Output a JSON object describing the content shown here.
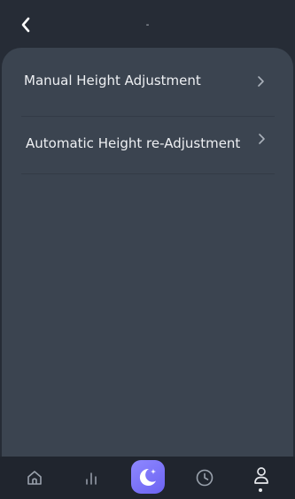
{
  "header": {
    "title": "-",
    "back_icon": "chevron-left-icon"
  },
  "menu": {
    "items": [
      {
        "label": "Manual Height Adjustment",
        "icon": "chevron-right-icon"
      },
      {
        "label": "Automatic Height re-Adjustment",
        "icon": "chevron-right-icon"
      }
    ]
  },
  "bottom_nav": {
    "items": [
      {
        "icon": "home-icon"
      },
      {
        "icon": "bar-chart-icon"
      },
      {
        "icon": "moon-star-icon",
        "selected": true
      },
      {
        "icon": "clock-icon"
      },
      {
        "icon": "user-icon",
        "active": true
      }
    ]
  },
  "colors": {
    "background": "#262c36",
    "panel": "#3b4450",
    "nav_background": "#20252e",
    "accent": "#7a72f7",
    "text": "#eef0f3"
  }
}
